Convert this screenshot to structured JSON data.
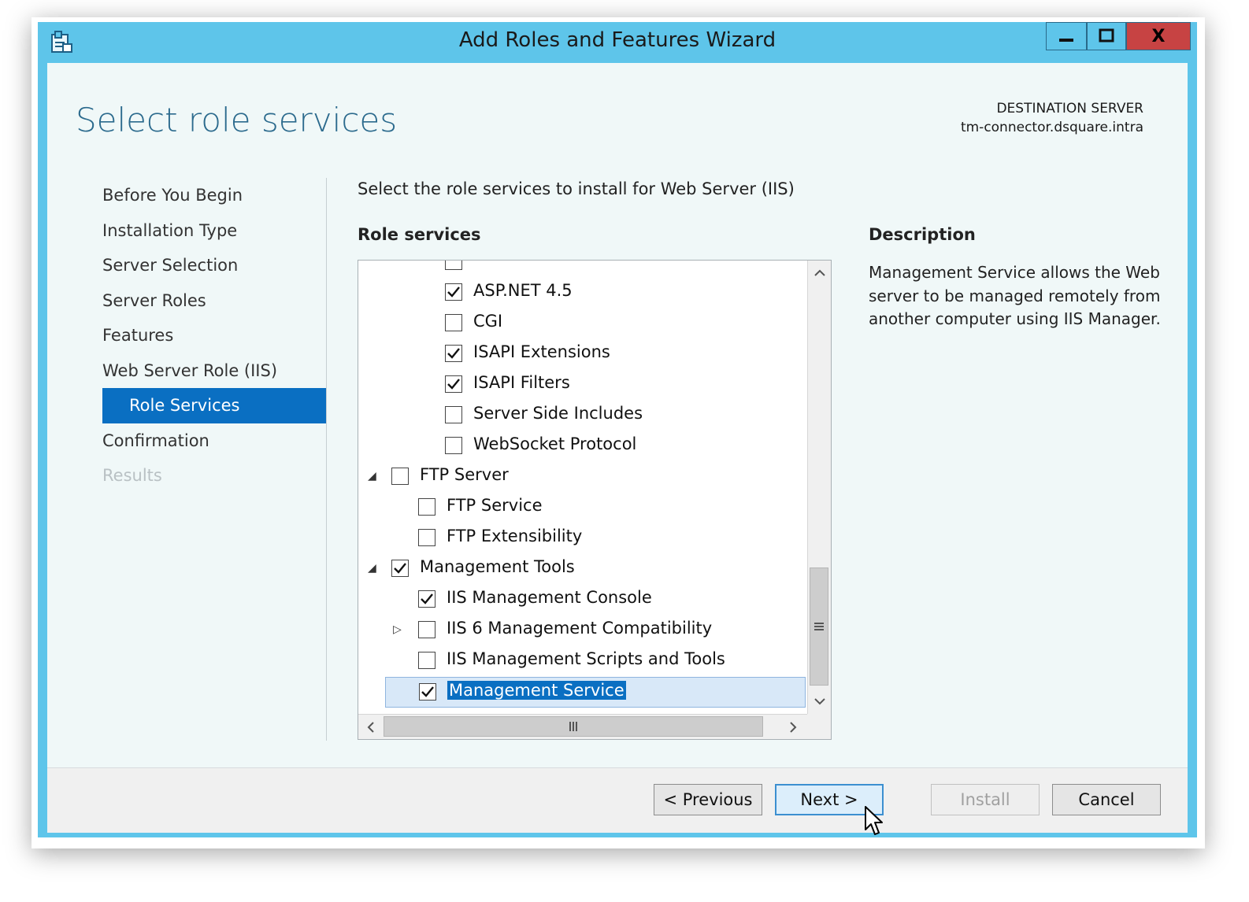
{
  "window": {
    "title": "Add Roles and Features Wizard",
    "close_glyph": "X"
  },
  "header": {
    "page_title": "Select role services",
    "destination_label": "DESTINATION SERVER",
    "destination_server": "tm-connector.dsquare.intra"
  },
  "nav": {
    "items": [
      {
        "label": "Before You Begin",
        "state": "normal"
      },
      {
        "label": "Installation Type",
        "state": "normal"
      },
      {
        "label": "Server Selection",
        "state": "normal"
      },
      {
        "label": "Server Roles",
        "state": "normal"
      },
      {
        "label": "Features",
        "state": "normal"
      },
      {
        "label": "Web Server Role (IIS)",
        "state": "normal"
      },
      {
        "label": "Role Services",
        "state": "active"
      },
      {
        "label": "Confirmation",
        "state": "normal"
      },
      {
        "label": "Results",
        "state": "disabled"
      }
    ]
  },
  "main": {
    "instruction": "Select the role services to install for Web Server (IIS)",
    "role_services_label": "Role services",
    "tree": [
      {
        "label": "ASP.NET 4.5",
        "checked": true,
        "level": 2,
        "expander": "none"
      },
      {
        "label": "CGI",
        "checked": false,
        "level": 2,
        "expander": "none"
      },
      {
        "label": "ISAPI Extensions",
        "checked": true,
        "level": 2,
        "expander": "none"
      },
      {
        "label": "ISAPI Filters",
        "checked": true,
        "level": 2,
        "expander": "none"
      },
      {
        "label": "Server Side Includes",
        "checked": false,
        "level": 2,
        "expander": "none"
      },
      {
        "label": "WebSocket Protocol",
        "checked": false,
        "level": 2,
        "expander": "none"
      },
      {
        "label": "FTP Server",
        "checked": false,
        "level": 0,
        "expander": "expanded"
      },
      {
        "label": "FTP Service",
        "checked": false,
        "level": 1,
        "expander": "none"
      },
      {
        "label": "FTP Extensibility",
        "checked": false,
        "level": 1,
        "expander": "none"
      },
      {
        "label": "Management Tools",
        "checked": true,
        "level": 0,
        "expander": "expanded"
      },
      {
        "label": "IIS Management Console",
        "checked": true,
        "level": 1,
        "expander": "none"
      },
      {
        "label": "IIS 6 Management Compatibility",
        "checked": false,
        "level": 1,
        "expander": "collapsed"
      },
      {
        "label": "IIS Management Scripts and Tools",
        "checked": false,
        "level": 1,
        "expander": "none"
      },
      {
        "label": "Management Service",
        "checked": true,
        "level": 1,
        "expander": "none",
        "selected": true
      }
    ]
  },
  "description": {
    "label": "Description",
    "text": "Management Service allows the Web server to be managed remotely from another computer using IIS Manager."
  },
  "footer": {
    "previous_label": "< Previous",
    "next_label": "Next >",
    "install_label": "Install",
    "cancel_label": "Cancel"
  },
  "colors": {
    "window_frame": "#5ec5ea",
    "accent": "#0a6fc2",
    "title_text": "#2b6a8d",
    "close_button": "#c74343"
  }
}
